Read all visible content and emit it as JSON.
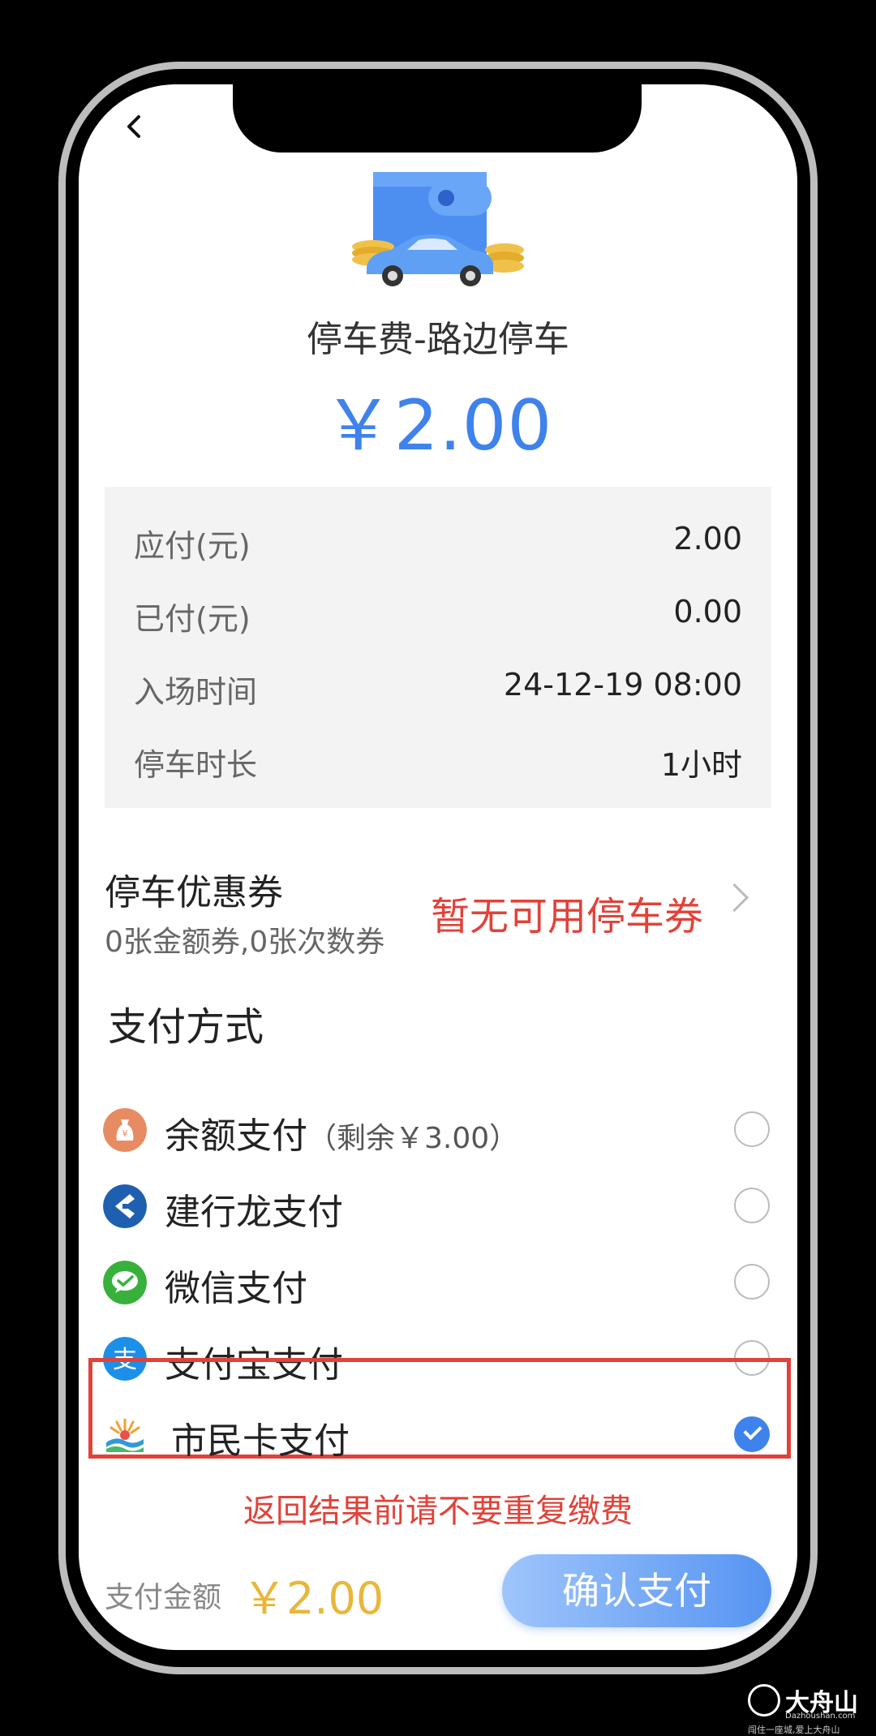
{
  "header": {
    "back_icon": "chevron-left-icon"
  },
  "order": {
    "title": "停车费-路边停车",
    "amount": "￥2.00"
  },
  "summary": [
    {
      "label": "应付(元)",
      "value": "2.00"
    },
    {
      "label": "已付(元)",
      "value": "0.00"
    },
    {
      "label": "入场时间",
      "value": "24-12-19 08:00"
    },
    {
      "label": "停车时长",
      "value": "1小时"
    }
  ],
  "coupon": {
    "title": "停车优惠券",
    "subtitle": "0张金额券,0张次数券",
    "status": "暂无可用停车券"
  },
  "payment": {
    "title": "支付方式",
    "methods": [
      {
        "label": "余额支付",
        "note": "（剩余￥3.00）",
        "icon": "money-bag-icon",
        "selected": false
      },
      {
        "label": "建行龙支付",
        "note": "",
        "icon": "ccb-icon",
        "selected": false
      },
      {
        "label": "微信支付",
        "note": "",
        "icon": "wechat-icon",
        "selected": false
      },
      {
        "label": "支付宝支付",
        "note": "",
        "icon": "alipay-icon",
        "selected": false
      },
      {
        "label": "市民卡支付",
        "note": "",
        "icon": "citizen-card-icon",
        "selected": true
      }
    ]
  },
  "warning": "返回结果前请不要重复缴费",
  "footer": {
    "label": "支付金额",
    "amount": "￥2.00",
    "confirm": "确认支付"
  },
  "colors": {
    "accent": "#3e82ec",
    "warning": "#e0433a",
    "amount_gold": "#e8b73a"
  },
  "watermark": {
    "title": "大舟山",
    "subtitle": "Dazhoushan.com",
    "slogan": "闯住一座城,爱上大舟山"
  }
}
